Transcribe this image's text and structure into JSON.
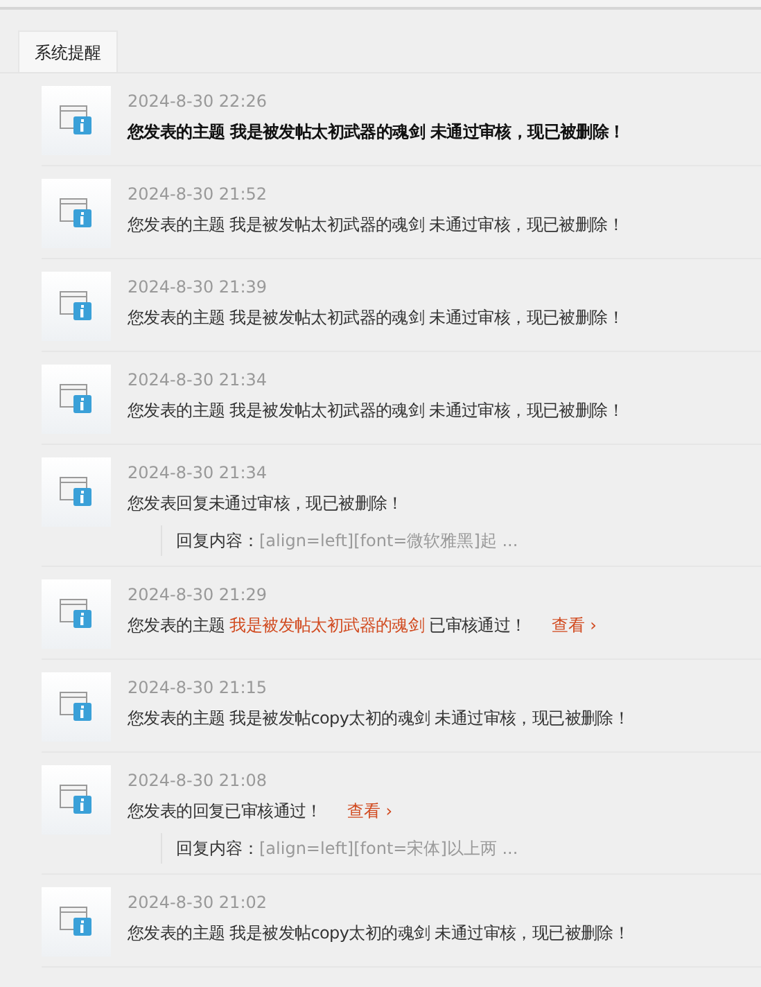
{
  "tabs": [
    {
      "label": "系统提醒",
      "selected": true
    }
  ],
  "notices": [
    {
      "time": "2024-8-30 22:26",
      "unread": true,
      "message": [
        {
          "kind": "plain",
          "text": "您发表的主题 我是被发帖太初武器的魂剑 未通过审核，现已被删除！"
        }
      ]
    },
    {
      "time": "2024-8-30 21:52",
      "unread": false,
      "message": [
        {
          "kind": "plain",
          "text": "您发表的主题 我是被发帖太初武器的魂剑 未通过审核，现已被删除！"
        }
      ]
    },
    {
      "time": "2024-8-30 21:39",
      "unread": false,
      "message": [
        {
          "kind": "plain",
          "text": "您发表的主题 我是被发帖太初武器的魂剑 未通过审核，现已被删除！"
        }
      ]
    },
    {
      "time": "2024-8-30 21:34",
      "unread": false,
      "message": [
        {
          "kind": "plain",
          "text": "您发表的主题 我是被发帖太初武器的魂剑 未通过审核，现已被删除！"
        }
      ]
    },
    {
      "time": "2024-8-30 21:34",
      "unread": false,
      "message": [
        {
          "kind": "plain",
          "text": "您发表回复未通过审核，现已被删除！"
        }
      ],
      "quote": {
        "label": "回复内容：",
        "value": "[align=left][font=微软雅黑]起 ..."
      }
    },
    {
      "time": "2024-8-30 21:29",
      "unread": false,
      "message": [
        {
          "kind": "plain",
          "text": "您发表的主题 "
        },
        {
          "kind": "link",
          "text": "我是被发帖太初武器的魂剑"
        },
        {
          "kind": "plain",
          "text": " 已审核通过！"
        }
      ],
      "view_link": "查看 ›"
    },
    {
      "time": "2024-8-30 21:15",
      "unread": false,
      "message": [
        {
          "kind": "plain",
          "text": "您发表的主题 我是被发帖copy太初的魂剑 未通过审核，现已被删除！"
        }
      ]
    },
    {
      "time": "2024-8-30 21:08",
      "unread": false,
      "message": [
        {
          "kind": "plain",
          "text": "您发表的回复已审核通过！"
        }
      ],
      "view_link": "查看 ›",
      "quote": {
        "label": "回复内容：",
        "value": "[align=left][font=宋体]以上两 ..."
      }
    },
    {
      "time": "2024-8-30 21:02",
      "unread": false,
      "message": [
        {
          "kind": "plain",
          "text": "您发表的主题 我是被发帖copy太初的魂剑 未通过审核，现已被删除！"
        }
      ]
    }
  ]
}
